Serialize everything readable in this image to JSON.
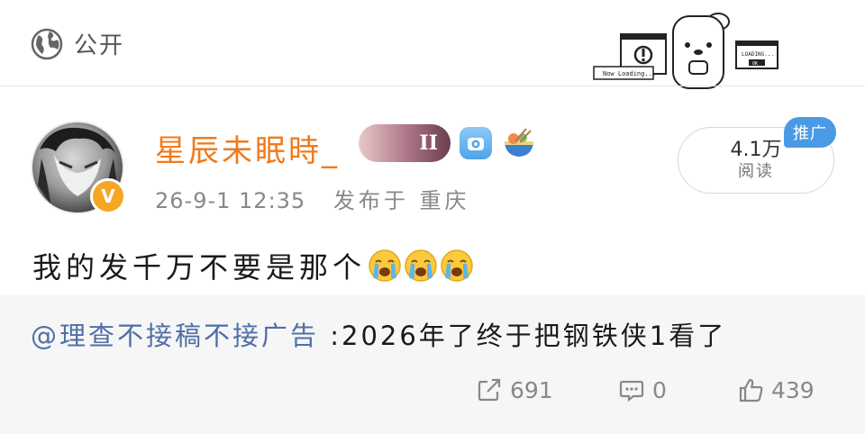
{
  "header": {
    "visibility_label": "公开",
    "decoration": {
      "left_window_text": "Now Loading...",
      "right_window_text": "LOADING...",
      "right_window_button": "OK"
    }
  },
  "post": {
    "author": {
      "name": "星辰未眠時_",
      "badge_text": "II",
      "verified_mark": "V"
    },
    "timestamp": "26-9-1 12:35",
    "location": "发布于 重庆",
    "read_count": "4.1万",
    "read_label": "阅读",
    "promo_tag": "推广",
    "text": "我的发千万不要是那个",
    "emojis": [
      "crying-emoji",
      "crying-emoji",
      "crying-emoji"
    ]
  },
  "repost": {
    "mention": "@理查不接稿不接广告",
    "text": ":2026年了终于把钢铁侠1看了"
  },
  "actions": {
    "share_count": "691",
    "comment_count": "0",
    "like_count": "439"
  },
  "colors": {
    "username": "#f07a1a",
    "mention": "#4f6fa6",
    "promo_tag": "#4a9ae6",
    "verified_badge": "#f5a623",
    "repost_bg": "#f6f6f6"
  }
}
